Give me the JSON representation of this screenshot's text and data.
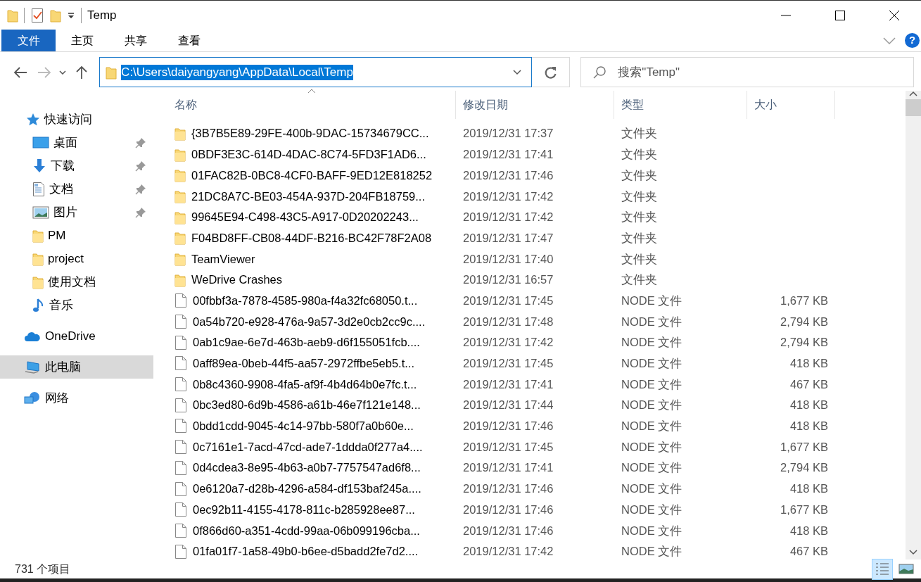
{
  "window": {
    "title": "Temp"
  },
  "ribbon": {
    "tabs": [
      {
        "label": "文件",
        "kind": "file"
      },
      {
        "label": "主页",
        "kind": "tab"
      },
      {
        "label": "共享",
        "kind": "tab"
      },
      {
        "label": "查看",
        "kind": "tab"
      }
    ],
    "help_label": "?"
  },
  "address": {
    "path": "C:\\Users\\daiyangyang\\AppData\\Local\\Temp",
    "selected": true
  },
  "search": {
    "placeholder": "搜索\"Temp\""
  },
  "sidebar": {
    "items": [
      {
        "label": "快速访问",
        "kind": "star",
        "selected": false,
        "children": [
          {
            "label": "桌面",
            "kind": "desktop",
            "pinned": true,
            "selected": false
          },
          {
            "label": "下载",
            "kind": "download",
            "pinned": true,
            "selected": false
          },
          {
            "label": "文档",
            "kind": "document",
            "pinned": true,
            "selected": false
          },
          {
            "label": "图片",
            "kind": "picture",
            "pinned": true,
            "selected": false
          },
          {
            "label": "PM",
            "kind": "folder",
            "pinned": false,
            "selected": false
          },
          {
            "label": "project",
            "kind": "folder",
            "pinned": false,
            "selected": false
          },
          {
            "label": "使用文档",
            "kind": "folder",
            "pinned": false,
            "selected": false
          },
          {
            "label": "音乐",
            "kind": "music",
            "pinned": false,
            "selected": false
          }
        ]
      },
      {
        "label": "OneDrive",
        "kind": "cloud",
        "selected": false
      },
      {
        "label": "此电脑",
        "kind": "computer",
        "selected": true
      },
      {
        "label": "网络",
        "kind": "network",
        "selected": false
      }
    ]
  },
  "table": {
    "columns": [
      {
        "label": "名称",
        "sorted": true
      },
      {
        "label": "修改日期",
        "sorted": false
      },
      {
        "label": "类型",
        "sorted": false
      },
      {
        "label": "大小",
        "sorted": false
      }
    ],
    "rows": [
      {
        "kind": "folder",
        "name": "{3B7B5E89-29FE-400b-9DAC-15734679CC...",
        "date": "2019/12/31 17:37",
        "type": "文件夹"
      },
      {
        "kind": "folder",
        "name": "0BDF3E3C-614D-4DAC-8C74-5FD3F1AD6...",
        "date": "2019/12/31 17:41",
        "type": "文件夹"
      },
      {
        "kind": "folder",
        "name": "01FAC82B-0BC8-4CF0-BAFF-9ED12E818252",
        "date": "2019/12/31 17:46",
        "type": "文件夹"
      },
      {
        "kind": "folder",
        "name": "21DC8A7C-BE03-454A-937D-204FB18759...",
        "date": "2019/12/31 17:42",
        "type": "文件夹"
      },
      {
        "kind": "folder",
        "name": "99645E94-C498-43C5-A917-0D20202243...",
        "date": "2019/12/31 17:42",
        "type": "文件夹"
      },
      {
        "kind": "folder",
        "name": "F04BD8FF-CB08-44DF-B216-BC42F78F2A08",
        "date": "2019/12/31 17:47",
        "type": "文件夹"
      },
      {
        "kind": "folder",
        "name": "TeamViewer",
        "date": "2019/12/31 17:40",
        "type": "文件夹"
      },
      {
        "kind": "folder",
        "name": "WeDrive Crashes",
        "date": "2019/12/31 16:57",
        "type": "文件夹"
      },
      {
        "kind": "file",
        "name": "00fbbf3a-7878-4585-980a-f4a32fc68050.t...",
        "date": "2019/12/31 17:45",
        "type": "NODE 文件",
        "size": "1,677 KB"
      },
      {
        "kind": "file",
        "name": "0a54b720-e928-476a-9a57-3d2e0cb2cc9c....",
        "date": "2019/12/31 17:48",
        "type": "NODE 文件",
        "size": "2,794 KB"
      },
      {
        "kind": "file",
        "name": "0ab1c9ae-6e7d-463b-aeb9-d6f155051fcb....",
        "date": "2019/12/31 17:42",
        "type": "NODE 文件",
        "size": "2,794 KB"
      },
      {
        "kind": "file",
        "name": "0aff89ea-0beb-44f5-aa57-2972ffbe5eb5.t...",
        "date": "2019/12/31 17:45",
        "type": "NODE 文件",
        "size": "418 KB"
      },
      {
        "kind": "file",
        "name": "0b8c4360-9908-4fa5-af9f-4b4d64b0e7fc.t...",
        "date": "2019/12/31 17:41",
        "type": "NODE 文件",
        "size": "467 KB"
      },
      {
        "kind": "file",
        "name": "0bc3ed80-6d9b-4586-a61b-46e7f121e148...",
        "date": "2019/12/31 17:44",
        "type": "NODE 文件",
        "size": "418 KB"
      },
      {
        "kind": "file",
        "name": "0bdd1cdd-9045-4c14-97bb-580f7a0b60e...",
        "date": "2019/12/31 17:46",
        "type": "NODE 文件",
        "size": "418 KB"
      },
      {
        "kind": "file",
        "name": "0c7161e1-7acd-47cd-ade7-1ddda0f277a4....",
        "date": "2019/12/31 17:45",
        "type": "NODE 文件",
        "size": "1,677 KB"
      },
      {
        "kind": "file",
        "name": "0d4cdea3-8e95-4b63-a0b7-7757547ad6f8...",
        "date": "2019/12/31 17:41",
        "type": "NODE 文件",
        "size": "2,794 KB"
      },
      {
        "kind": "file",
        "name": "0e6120a7-d28b-4296-a584-df153baf245a....",
        "date": "2019/12/31 17:46",
        "type": "NODE 文件",
        "size": "418 KB"
      },
      {
        "kind": "file",
        "name": "0ec92b11-4155-4178-811c-b285928ee87...",
        "date": "2019/12/31 17:46",
        "type": "NODE 文件",
        "size": "1,677 KB"
      },
      {
        "kind": "file",
        "name": "0f866d60-a351-4cdd-99aa-06b099196cba...",
        "date": "2019/12/31 17:46",
        "type": "NODE 文件",
        "size": "418 KB"
      },
      {
        "kind": "file",
        "name": "01fa01f7-1a58-49b0-b6ee-d5badd2fe7d2....",
        "date": "2019/12/31 17:42",
        "type": "NODE 文件",
        "size": "467 KB"
      }
    ]
  },
  "status_bar": {
    "item_count": "731 个项目",
    "views": [
      {
        "kind": "details",
        "selected": true
      },
      {
        "kind": "thumbnails",
        "selected": false
      }
    ]
  }
}
